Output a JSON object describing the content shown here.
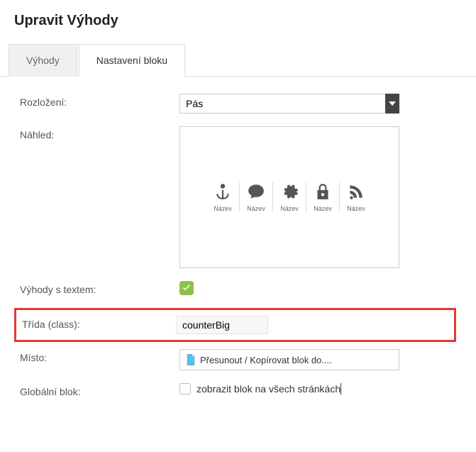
{
  "header": {
    "title": "Upravit Výhody"
  },
  "tabs": [
    {
      "label": "Výhody",
      "active": false
    },
    {
      "label": "Nastavení bloku",
      "active": true
    }
  ],
  "labels": {
    "rozlozeni": "Rozložení:",
    "nahled": "Náhled:",
    "vyhody_text": "Výhody s textem:",
    "trida": "Třída (class):",
    "misto": "Místo:",
    "globalni_blok": "Globální blok:"
  },
  "rozlozeni": {
    "selected": "Pás"
  },
  "preview_items": [
    {
      "icon": "anchor-icon",
      "label": "Název"
    },
    {
      "icon": "comment-icon",
      "label": "Název"
    },
    {
      "icon": "gear-icon",
      "label": "Název"
    },
    {
      "icon": "lock-icon",
      "label": "Název"
    },
    {
      "icon": "rss-icon",
      "label": "Název"
    }
  ],
  "vyhody_text_checked": true,
  "trida": {
    "value": "counterBig"
  },
  "misto": {
    "button": "Přesunout / Kopírovat blok do...."
  },
  "globalni_blok": {
    "checked": false,
    "label": "zobrazit blok na všech stránkách"
  }
}
